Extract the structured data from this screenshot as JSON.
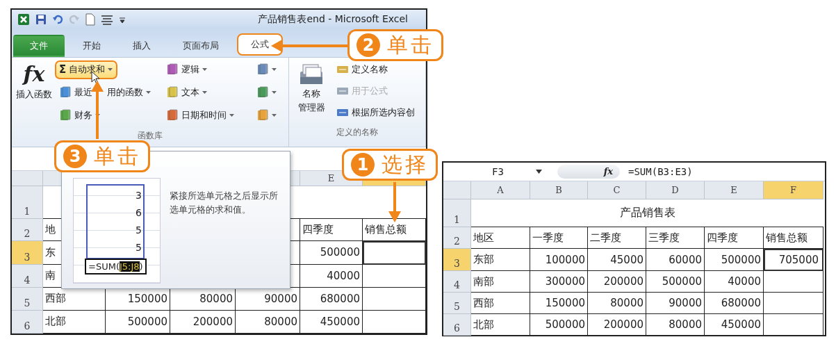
{
  "left_window": {
    "title": "产品销售表end - Microsoft Excel",
    "tabs": [
      {
        "label": "文件",
        "kind": "file",
        "selected": false
      },
      {
        "label": "开始",
        "kind": "tab",
        "selected": false
      },
      {
        "label": "插入",
        "kind": "tab",
        "selected": false
      },
      {
        "label": "页面布局",
        "kind": "tab",
        "selected": false
      },
      {
        "label": "公式",
        "kind": "tab",
        "selected": true
      }
    ],
    "function_library": {
      "label": "函数库",
      "insert_function": {
        "icon_text": "fx",
        "label": "插入函数"
      },
      "items": [
        {
          "kind": "sum",
          "icon_text": "Σ",
          "label": "自动求和",
          "highlighted": true
        },
        {
          "kind": "recent",
          "label": "最近",
          "label_after": "用的函数",
          "highlighted": false
        },
        {
          "kind": "finance",
          "label": "财务",
          "highlighted": false
        },
        {
          "kind": "logic",
          "label": "逻辑",
          "highlighted": false
        },
        {
          "kind": "text",
          "label": "文本",
          "highlighted": false
        },
        {
          "kind": "datetime",
          "label": "日期和时间",
          "highlighted": false
        },
        {
          "kind": "lookup",
          "highlighted": false
        },
        {
          "kind": "math",
          "highlighted": false
        },
        {
          "kind": "more",
          "highlighted": false
        }
      ]
    },
    "defined_names": {
      "label": "定义的名称",
      "name_manager": [
        "名称",
        "管理器"
      ],
      "items": [
        {
          "kind": "define",
          "label": "定义名称",
          "disabled": false
        },
        {
          "kind": "use",
          "label": "用于公式",
          "disabled": true
        },
        {
          "kind": "create",
          "label": "根据所选内容创",
          "disabled": false
        }
      ]
    },
    "popup": {
      "preview_values": [
        "3",
        "6",
        "5",
        "5"
      ],
      "formula_start": "=SUM(",
      "formula_range": "J5:J8",
      "formula_end": ")",
      "description": "紧接所选单元格之后显示所选单元格的求和值。"
    },
    "sheet": {
      "columns": [
        {
          "label": "E",
          "selected": false
        },
        {
          "selected": true
        }
      ],
      "rows": [
        {
          "number": "1",
          "kind": "title",
          "selected": false
        },
        {
          "number": "2",
          "kind": "header",
          "selected": false,
          "cells": [
            "地",
            null,
            null,
            null,
            "四季度",
            "销售总额"
          ]
        },
        {
          "number": "3",
          "kind": "data",
          "selected": true,
          "cells": [
            "东",
            null,
            null,
            null,
            "500000",
            null
          ]
        },
        {
          "number": "4",
          "kind": "data",
          "selected": false,
          "cells": [
            "南",
            null,
            null,
            null,
            "40000",
            null
          ]
        },
        {
          "number": "5",
          "kind": "data",
          "selected": false,
          "cells": [
            "西部",
            "150000",
            "80000",
            "90000",
            "680000",
            null
          ]
        },
        {
          "number": "6",
          "kind": "data",
          "selected": false,
          "cells": [
            "北部",
            "500000",
            "200000",
            "80000",
            "450000",
            null
          ]
        }
      ]
    }
  },
  "right_window": {
    "name_box": "F3",
    "fx": "fx",
    "formula": "=SUM(B3:E3)",
    "sheet": {
      "columns": [
        {
          "label": "A",
          "selected": false
        },
        {
          "label": "B",
          "selected": false
        },
        {
          "label": "C",
          "selected": false
        },
        {
          "label": "D",
          "selected": false
        },
        {
          "label": "E",
          "selected": false
        },
        {
          "label": "F",
          "selected": true
        }
      ],
      "rows": [
        {
          "number": "1",
          "kind": "title",
          "selected": false,
          "title": "产品销售表"
        },
        {
          "number": "2",
          "kind": "header",
          "selected": false,
          "cells": [
            "地区",
            "一季度",
            "二季度",
            "三季度",
            "四季度",
            "销售总额"
          ]
        },
        {
          "number": "3",
          "kind": "data",
          "selected": true,
          "cells": [
            "东部",
            "100000",
            "45000",
            "60000",
            "500000",
            "705000"
          ]
        },
        {
          "number": "4",
          "kind": "data",
          "selected": false,
          "cells": [
            "南部",
            "300000",
            "200000",
            "500000",
            "40000",
            null
          ]
        },
        {
          "number": "5",
          "kind": "data",
          "selected": false,
          "cells": [
            "西部",
            "150000",
            "80000",
            "90000",
            "680000",
            null
          ]
        },
        {
          "number": "6",
          "kind": "data",
          "selected": false,
          "cells": [
            "北部",
            "500000",
            "200000",
            "80000",
            "450000",
            null
          ]
        }
      ]
    }
  },
  "callouts": [
    {
      "number": "2",
      "label": "单击"
    },
    {
      "number": "3",
      "label": "单击"
    },
    {
      "number": "1",
      "label": "选择"
    }
  ]
}
